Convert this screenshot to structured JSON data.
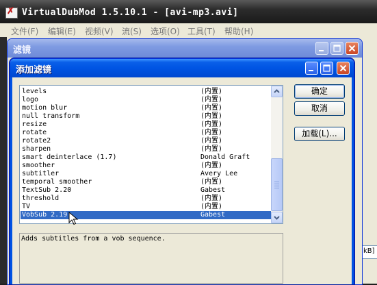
{
  "main_window": {
    "title": "VirtualDubMod 1.5.10.1 - [avi-mp3.avi]",
    "icon": "virtualdub-app-icon",
    "menu": [
      "文件(F)",
      "编辑(E)",
      "视频(V)",
      "流(S)",
      "选项(O)",
      "工具(T)",
      "帮助(H)"
    ],
    "status_fragment": "kB]"
  },
  "filters_window": {
    "title": "滤镜"
  },
  "add_filter_dialog": {
    "title": "添加滤镜",
    "filters": [
      {
        "name": "levels",
        "author": "(内置)"
      },
      {
        "name": "logo",
        "author": "(内置)"
      },
      {
        "name": "motion blur",
        "author": "(内置)"
      },
      {
        "name": "null transform",
        "author": "(内置)"
      },
      {
        "name": "resize",
        "author": "(内置)"
      },
      {
        "name": "rotate",
        "author": "(内置)"
      },
      {
        "name": "rotate2",
        "author": "(内置)"
      },
      {
        "name": "sharpen",
        "author": "(内置)"
      },
      {
        "name": "smart deinterlace (1.7)",
        "author": "Donald Graft"
      },
      {
        "name": "smoother",
        "author": "(内置)"
      },
      {
        "name": "subtitler",
        "author": "Avery Lee"
      },
      {
        "name": "temporal smoother",
        "author": "(内置)"
      },
      {
        "name": "TextSub 2.20",
        "author": "Gabest"
      },
      {
        "name": "threshold",
        "author": "(内置)"
      },
      {
        "name": "TV",
        "author": "(内置)"
      },
      {
        "name": "VobSub 2.19",
        "author": "Gabest"
      }
    ],
    "selected_filter": "VobSub 2.19",
    "description": "Adds subtitles from a vob sequence.",
    "buttons": {
      "ok": "确定",
      "cancel": "取消",
      "load": "加载(L)..."
    }
  },
  "colors": {
    "selection": "#316ac5",
    "xp_title_blue": "#0054e3",
    "inactive_title": "#7f9be2"
  }
}
